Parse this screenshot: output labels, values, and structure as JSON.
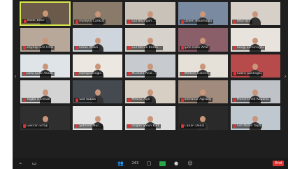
{
  "app": {
    "name": "Zoom meeting gallery view"
  },
  "gallery": {
    "participants": [
      {
        "name": "Nadir Bekir",
        "bg": "#6b5a4a",
        "speaking": true
      },
      {
        "name": "Hüseyin Cankut",
        "bg": "#8a7a6a"
      },
      {
        "name": "Gül Bezirgan...",
        "bg": "#c9c2b8"
      },
      {
        "name": "Özlem Nizamoğlu",
        "bg": "#7a8aa0"
      },
      {
        "name": "Ülkü Iştir",
        "bg": "#d6d0c8"
      },
      {
        "name": "Zeynep Ece Önal",
        "bg": "#b7a89a"
      },
      {
        "name": "Erkan Ataklı",
        "bg": "#cfd5dc"
      },
      {
        "name": "Gül Merve Kazan...",
        "bg": "#d8d2cc"
      },
      {
        "name": "Şirin Dilek Acar",
        "bg": "#8a5f6a"
      },
      {
        "name": "Sevgi Sarsıcıoğlu",
        "bg": "#e8e3dd"
      },
      {
        "name": "Ebru Çelik Aksak",
        "bg": "#dfe4e8"
      },
      {
        "name": "Hemşirecioğlu",
        "bg": "#ece7e0"
      },
      {
        "name": "Mustafa Acar...",
        "bg": "#c7cbd0"
      },
      {
        "name": "Meltem Gökcen",
        "bg": "#e5e1d8"
      },
      {
        "name": "Sukru Şanlıoğlu",
        "bg": "#b74a4a"
      },
      {
        "name": "Tuğba Ü.Elmalı",
        "bg": "#d3d3d3"
      },
      {
        "name": "Sait Kübük",
        "bg": "#444a50"
      },
      {
        "name": "Mesrur Açık",
        "bg": "#d8cfc4"
      },
      {
        "name": "Semanur Ağırbaş",
        "bg": "#a08b7c"
      },
      {
        "name": "Muhammed Kapanci",
        "bg": "#bfc3c8"
      },
      {
        "name": "Gökcan Ertaş",
        "bg": "#2f2f2f"
      },
      {
        "name": "Şebnem Nur...",
        "bg": "#e4e4e4"
      },
      {
        "name": "Doğan Şahin Kurt",
        "bg": "#dedede"
      },
      {
        "name": "Canan Deniz",
        "bg": "#2a2a2a"
      },
      {
        "name": "Sıla Nalan Yaşa",
        "bg": "#bfc7cf"
      }
    ]
  },
  "toolbar": {
    "participants_count": "243",
    "left_icons": [
      "mic-icon",
      "video-icon"
    ],
    "center_icons": [
      "participants-icon",
      "chat-icon",
      "share-icon",
      "record-icon",
      "reactions-icon"
    ],
    "end_label": "End"
  }
}
